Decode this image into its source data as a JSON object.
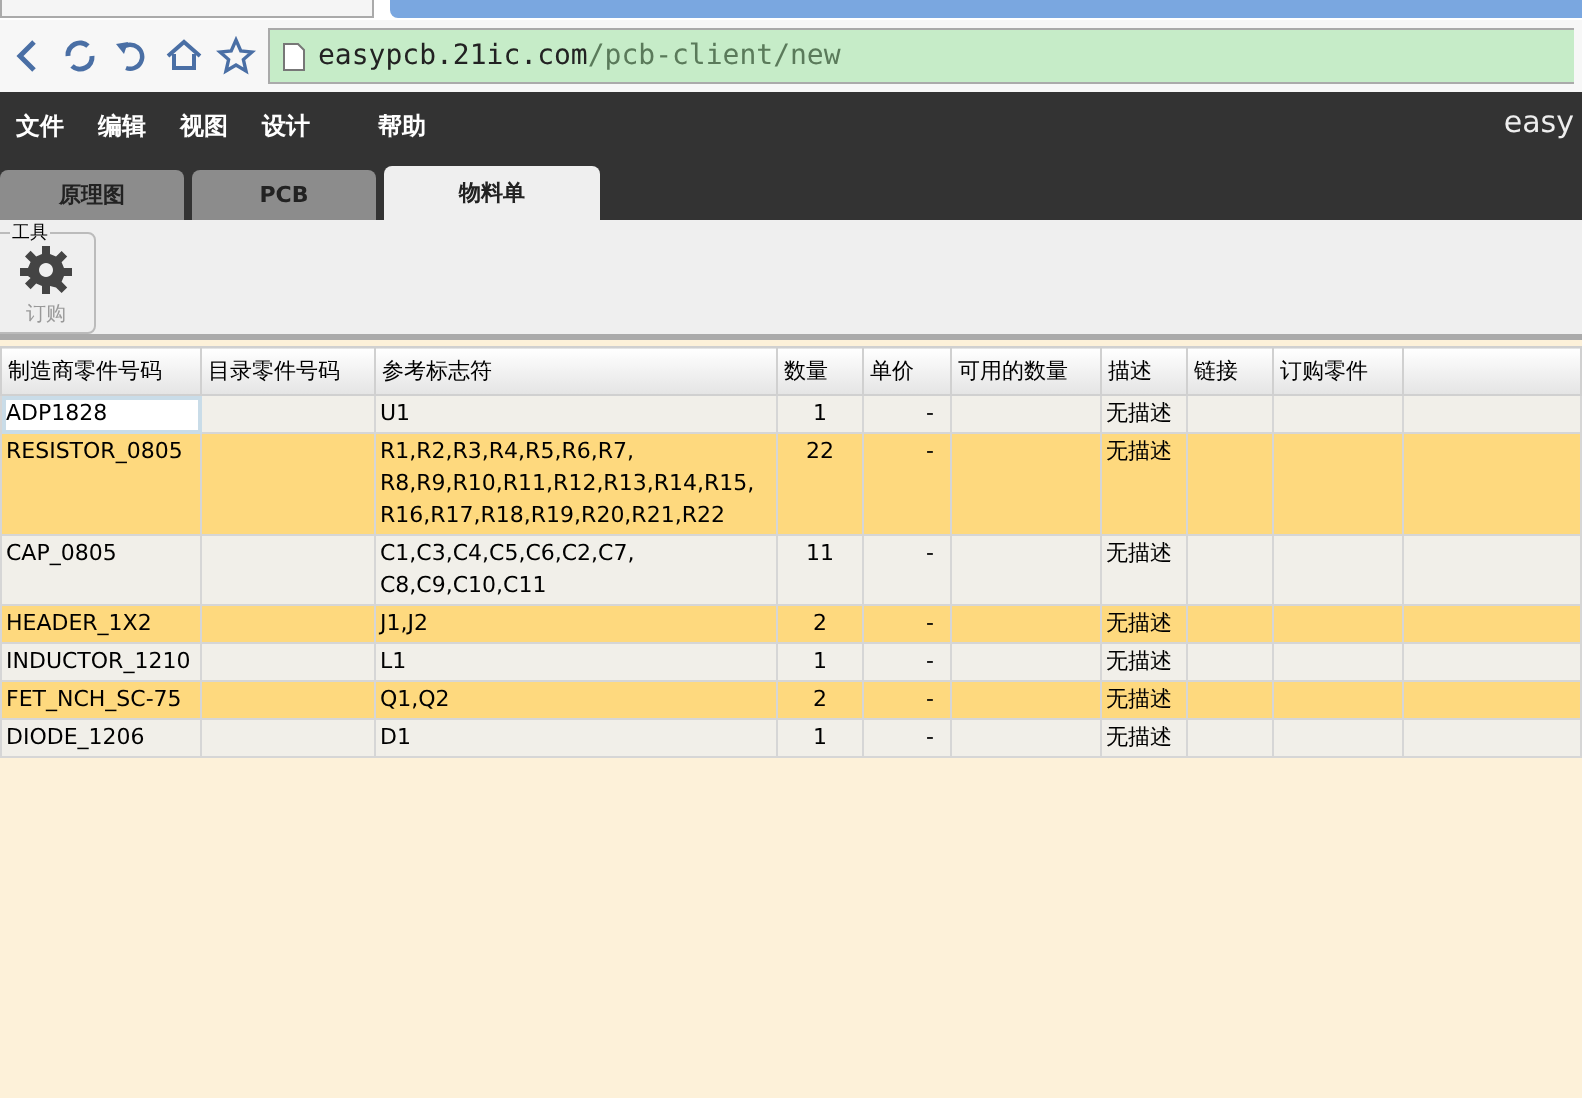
{
  "browser": {
    "url_host": "easypcb.21ic.com",
    "url_path": "/pcb-client/new"
  },
  "menu": [
    "文件",
    "编辑",
    "视图",
    "设计",
    "帮助"
  ],
  "brand": "easy",
  "tabs": [
    {
      "label": "原理图",
      "selected": false
    },
    {
      "label": "PCB",
      "selected": false
    },
    {
      "label": "物料单",
      "selected": true
    }
  ],
  "toolbar": {
    "group_label": "工具",
    "button_label": "订购"
  },
  "table": {
    "columns": [
      "制造商零件号码",
      "目录零件号码",
      "参考标志符",
      "数量",
      "单价",
      "可用的数量",
      "描述",
      "链接",
      "订购零件"
    ],
    "rows": [
      {
        "part": "ADP1828",
        "reference": [
          "U1"
        ],
        "quantity": "1",
        "price": "-",
        "description": "无描述",
        "selected": true
      },
      {
        "part": "RESISTOR_0805",
        "reference": [
          "R1,R2,R3,R4,R5,R6,R7,",
          "R8,R9,R10,R11,R12,R13,R14,R15,",
          "R16,R17,R18,R19,R20,R21,R22"
        ],
        "quantity": "22",
        "price": "-",
        "description": "无描述",
        "selected": false
      },
      {
        "part": "CAP_0805",
        "reference": [
          "C1,C3,C4,C5,C6,C2,C7,",
          "C8,C9,C10,C11"
        ],
        "quantity": "11",
        "price": "-",
        "description": "无描述",
        "selected": false
      },
      {
        "part": "HEADER_1X2",
        "reference": [
          "J1,J2"
        ],
        "quantity": "2",
        "price": "-",
        "description": "无描述",
        "selected": false
      },
      {
        "part": "INDUCTOR_1210",
        "reference": [
          "L1"
        ],
        "quantity": "1",
        "price": "-",
        "description": "无描述",
        "selected": false
      },
      {
        "part": "FET_NCH_SC-75",
        "reference": [
          "Q1,Q2"
        ],
        "quantity": "2",
        "price": "-",
        "description": "无描述",
        "selected": false
      },
      {
        "part": "DIODE_1206",
        "reference": [
          "D1"
        ],
        "quantity": "1",
        "price": "-",
        "description": "无描述",
        "selected": false
      }
    ]
  }
}
